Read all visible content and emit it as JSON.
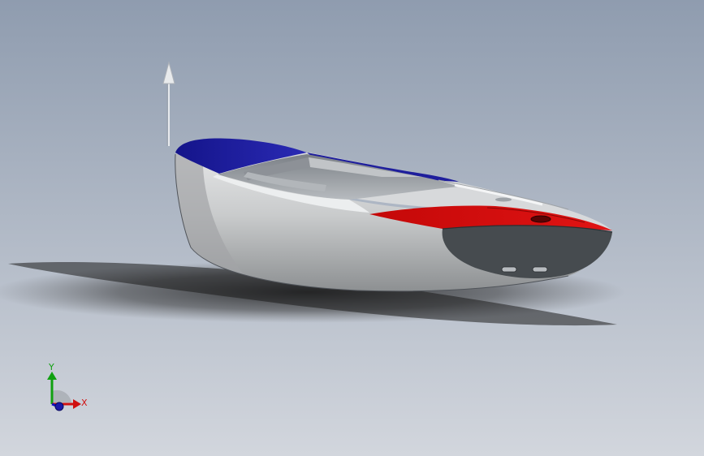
{
  "viewport": {
    "background_top": "#8f9caf",
    "background_bottom": "#d2d6dd"
  },
  "model": {
    "hull_color": "#c8cacc",
    "deck_blue": "#1a1a9a",
    "deck_red": "#d20a0a",
    "transom_color": "#454a4e"
  },
  "triad": {
    "x_label": "X",
    "y_label": "Y",
    "x_color": "#d01010",
    "y_color": "#10a010",
    "z_color": "#1010c0"
  }
}
